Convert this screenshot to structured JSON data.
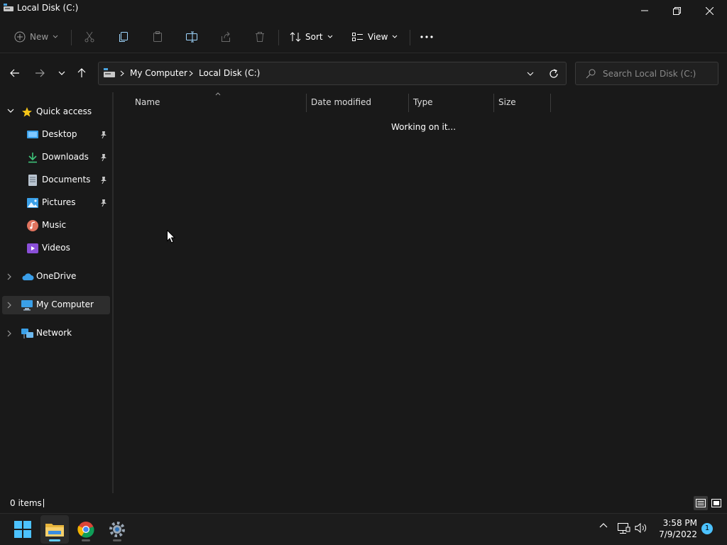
{
  "window": {
    "title": "Local Disk (C:)"
  },
  "toolbar": {
    "new_label": "New",
    "sort_label": "Sort",
    "view_label": "View"
  },
  "address": {
    "crumbs": [
      "My Computer",
      "Local Disk (C:)"
    ]
  },
  "search": {
    "placeholder": "Search Local Disk (C:)"
  },
  "sidebar": {
    "quick_access": "Quick access",
    "items": [
      {
        "label": "Desktop",
        "icon": "desktop-icon",
        "pinned": true
      },
      {
        "label": "Downloads",
        "icon": "download-icon",
        "pinned": true
      },
      {
        "label": "Documents",
        "icon": "document-icon",
        "pinned": true
      },
      {
        "label": "Pictures",
        "icon": "pictures-icon",
        "pinned": true
      },
      {
        "label": "Music",
        "icon": "music-icon",
        "pinned": false
      },
      {
        "label": "Videos",
        "icon": "videos-icon",
        "pinned": false
      }
    ],
    "onedrive": "OneDrive",
    "my_computer": "My Computer",
    "network": "Network"
  },
  "columns": {
    "name": "Name",
    "date_modified": "Date modified",
    "type": "Type",
    "size": "Size"
  },
  "content": {
    "status_message": "Working on it..."
  },
  "status": {
    "items_count": "0 items"
  },
  "taskbar": {
    "time": "3:58 PM",
    "date": "7/9/2022",
    "notification_count": "1"
  },
  "colors": {
    "background": "#191919",
    "accent": "#60cdff",
    "selected": "#2d2d2d"
  }
}
